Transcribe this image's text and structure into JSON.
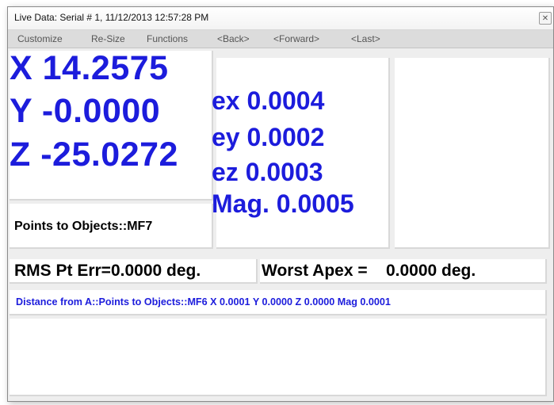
{
  "window": {
    "title": "Live Data:  Serial # 1, 11/12/2013 12:57:28 PM",
    "close_glyph": "✕"
  },
  "menu": {
    "items": [
      "Customize",
      "Re-Size",
      "Functions",
      "<Back>",
      "<Forward>",
      "<Last>"
    ]
  },
  "coords": {
    "x": "X 14.2575",
    "y": "Y -0.0000",
    "z": "Z -25.0272"
  },
  "errors": {
    "ex": "ex 0.0004",
    "ey": "ey 0.0002",
    "ez": "ez 0.0003",
    "mag": "Mag. 0.0005"
  },
  "feature_name": "Points to Objects::MF7",
  "rms": "RMS Pt Err=0.0000 deg.",
  "worst_apex": "Worst Apex =    0.0000 deg.",
  "distance": "Distance from A::Points to Objects::MF6 X 0.0001 Y 0.0000 Z 0.0000 Mag 0.0001",
  "colors": {
    "value_blue": "#1c1cdc",
    "panel_bg": "#ffffff",
    "window_bg": "#eeeeee",
    "menu_bg": "#dcdcdc"
  }
}
